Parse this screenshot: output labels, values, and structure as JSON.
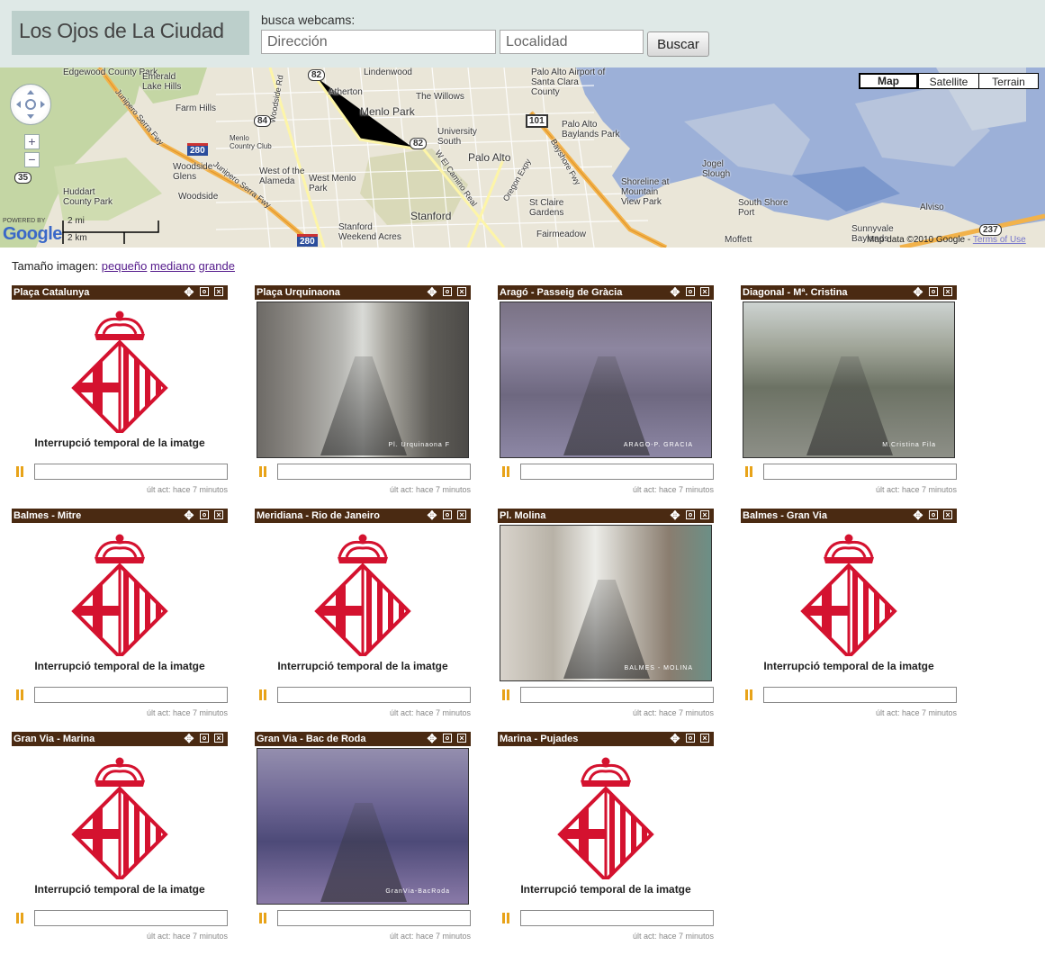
{
  "header": {
    "logo": "Los Ojos de La Ciudad",
    "search_label": "busca webcams:",
    "address_placeholder": "Dirección",
    "city_placeholder": "Localidad",
    "search_button": "Buscar"
  },
  "map": {
    "types": [
      "Map",
      "Satellite",
      "Terrain"
    ],
    "selected_type": "Map",
    "zoom_in": "+",
    "zoom_out": "−",
    "scale_mi": "2 mi",
    "scale_km": "2 km",
    "powered_by": "POWERED BY",
    "logo": "Google",
    "copyright": "Map data ©2010 Google - ",
    "terms": "Terms of Use",
    "colors": {
      "water": "#9cb0d8",
      "land": "#eae6d8",
      "park": "#c4d6a4",
      "highway": "#f2b24a",
      "road": "#fdf5a8"
    },
    "places": [
      "Edgewood County Park",
      "Emerald Lake Hills",
      "Farm Hills",
      "Menlo Country Club",
      "Woodside Glens",
      "Woodside",
      "Huddart County Park",
      "Atherton",
      "Lindenwood",
      "The Willows",
      "Menlo Park",
      "University South",
      "Palo Alto",
      "Palo Alto Airport of Santa Clara County",
      "Palo Alto Baylands Park",
      "West of the Alameda",
      "West Menlo Park",
      "Stanford",
      "Stanford Weekend Acres",
      "St Claire Gardens",
      "Fairmeadow",
      "Shoreline at Mountain View Park",
      "Jogel Slough",
      "South Shore Port",
      "Sunnyvale Baylands",
      "Alviso",
      "Moffett",
      "Junipero Serra Fwy",
      "W El Camino Real",
      "Bayshore Fwy",
      "Oregon Expy",
      "Woodside Rd"
    ],
    "shields": [
      "82",
      "84",
      "280",
      "101",
      "35",
      "237"
    ]
  },
  "size_line": {
    "label": "Tamaño imagen:",
    "options": [
      "pequeño",
      "mediano",
      "grande"
    ]
  },
  "cams": [
    {
      "title": "Plaça Catalunya",
      "status": "interrupted",
      "interrupted_text": "Interrupció temporal de la imatge",
      "updated": "últ act: hace 7 minutos"
    },
    {
      "title": "Plaça Urquinaona",
      "status": "live",
      "stamp": "Pl. Urquinaona F",
      "updated": "últ act: hace 7 minutos"
    },
    {
      "title": "Aragó - Passeig de Gràcia",
      "status": "live",
      "stamp": "ARAGO-P. GRACIA",
      "updated": "últ act: hace 7 minutos"
    },
    {
      "title": "Diagonal - Mª. Cristina",
      "status": "live",
      "stamp": "M.Cristina Fila",
      "updated": "últ act: hace 7 minutos"
    },
    {
      "title": "Balmes - Mitre",
      "status": "interrupted",
      "interrupted_text": "Interrupció temporal de la imatge",
      "updated": "últ act: hace 7 minutos"
    },
    {
      "title": "Meridiana - Rio de Janeiro",
      "status": "interrupted",
      "interrupted_text": "Interrupció temporal de la imatge",
      "updated": "últ act: hace 7 minutos"
    },
    {
      "title": "Pl. Molina",
      "status": "live",
      "stamp": "BALMES - MOLINA",
      "updated": "últ act: hace 7 minutos"
    },
    {
      "title": "Balmes - Gran Via",
      "status": "interrupted",
      "interrupted_text": "Interrupció temporal de la imatge",
      "updated": "últ act: hace 7 minutos"
    },
    {
      "title": "Gran Via - Marina",
      "status": "interrupted",
      "interrupted_text": "Interrupció temporal de la imatge",
      "updated": "últ act: hace 7 minutos"
    },
    {
      "title": "Gran Via - Bac de Roda",
      "status": "live",
      "stamp": "GranVia-BacRoda",
      "updated": "últ act: hace 7 minutos"
    },
    {
      "title": "Marina - Pujades",
      "status": "interrupted",
      "interrupted_text": "Interrupció temporal de la imatge",
      "updated": "últ act: hace 7 minutos"
    }
  ],
  "icons": {
    "move": "move-icon",
    "refresh": "refresh-icon",
    "close": "close-icon",
    "pause": "pause-icon"
  }
}
